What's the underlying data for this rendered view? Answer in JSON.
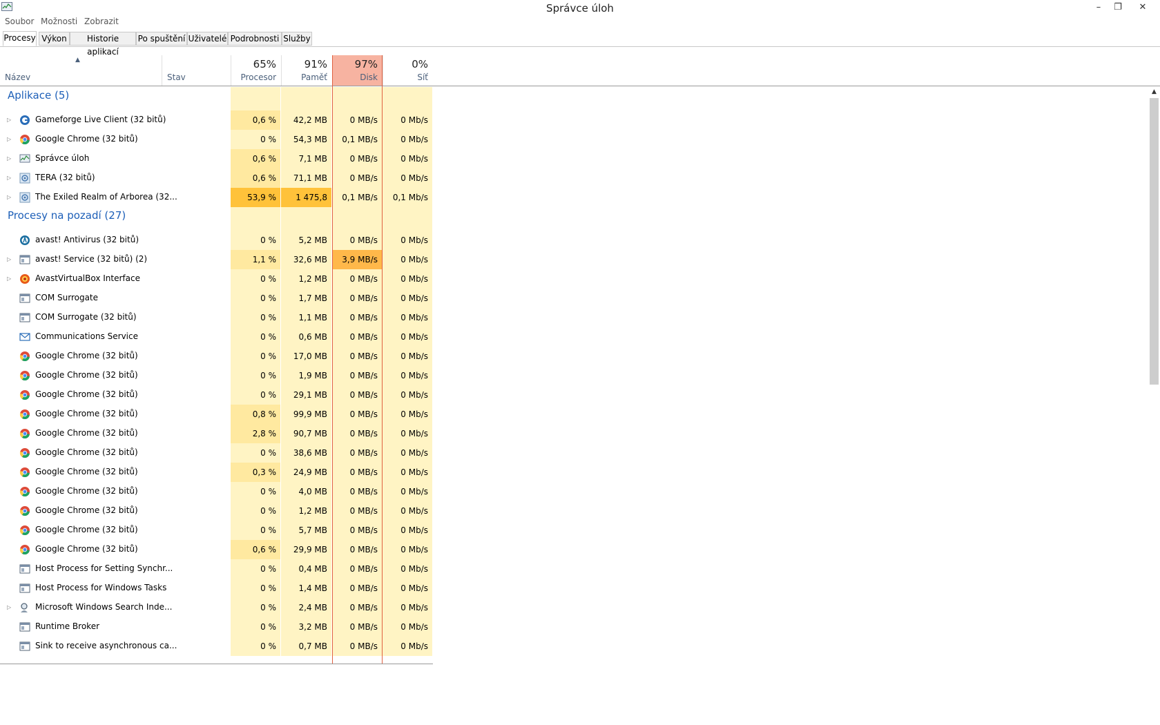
{
  "window": {
    "title": "Správce úloh",
    "minimize": "–",
    "maximize": "❐",
    "close": "✕"
  },
  "menu": [
    "Soubor",
    "Možnosti",
    "Zobrazit"
  ],
  "tabs": [
    "Procesy",
    "Výkon",
    "Historie aplikací",
    "Po spuštění",
    "Uživatelé",
    "Podrobnosti",
    "Služby"
  ],
  "active_tab": "Procesy",
  "columns": {
    "name": "Název",
    "status": "Stav",
    "cpu": {
      "pct": "65%",
      "label": "Procesor"
    },
    "mem": {
      "pct": "91%",
      "label": "Paměť"
    },
    "disk": {
      "pct": "97%",
      "label": "Disk"
    },
    "net": {
      "pct": "0%",
      "label": "Síť"
    }
  },
  "colors": {
    "accent": "#1d5fb8",
    "light_yellow": "#fff4c4",
    "medium_yellow": "#ffe9a0",
    "strong_orange": "#ffc23a",
    "disk_header": "#f7b3a1",
    "disk_highlight": "#ffb84a"
  },
  "groups": [
    {
      "title": "Aplikace (5)",
      "rows": [
        {
          "icon": "gameforge-icon",
          "name": "Gameforge Live Client (32 bitů)",
          "expand": true,
          "cpu": "0,6 %",
          "mem": "42,2 MB",
          "disk": "0 MB/s",
          "net": "0 Mb/s",
          "cpu_heat": 1,
          "mem_heat": 0,
          "disk_heat": 0
        },
        {
          "icon": "chrome-icon",
          "name": "Google Chrome (32 bitů)",
          "expand": true,
          "cpu": "0 %",
          "mem": "54,3 MB",
          "disk": "0,1 MB/s",
          "net": "0 Mb/s",
          "cpu_heat": 0,
          "mem_heat": 0,
          "disk_heat": 0
        },
        {
          "icon": "taskmanager-icon",
          "name": "Správce úloh",
          "expand": true,
          "cpu": "0,6 %",
          "mem": "7,1 MB",
          "disk": "0 MB/s",
          "net": "0 Mb/s",
          "cpu_heat": 1,
          "mem_heat": 0,
          "disk_heat": 0
        },
        {
          "icon": "tera-icon",
          "name": "TERA (32 bitů)",
          "expand": true,
          "cpu": "0,6 %",
          "mem": "71,1 MB",
          "disk": "0 MB/s",
          "net": "0 Mb/s",
          "cpu_heat": 1,
          "mem_heat": 0,
          "disk_heat": 0
        },
        {
          "icon": "tera-icon",
          "name": "The Exiled Realm of Arborea (32...",
          "expand": true,
          "cpu": "53,9 %",
          "mem": "1 475,8 MB",
          "disk": "0,1 MB/s",
          "net": "0,1 Mb/s",
          "cpu_heat": 3,
          "mem_heat": 3,
          "disk_heat": 0
        }
      ]
    },
    {
      "title": "Procesy na pozadí (27)",
      "rows": [
        {
          "icon": "avast-icon",
          "name": "avast! Antivirus (32 bitů)",
          "expand": false,
          "cpu": "0 %",
          "mem": "5,2 MB",
          "disk": "0 MB/s",
          "net": "0 Mb/s",
          "cpu_heat": 0,
          "mem_heat": 0,
          "disk_heat": 0
        },
        {
          "icon": "service-icon",
          "name": "avast! Service (32 bitů) (2)",
          "expand": true,
          "cpu": "1,1 %",
          "mem": "32,6 MB",
          "disk": "3,9 MB/s",
          "net": "0 Mb/s",
          "cpu_heat": 1,
          "mem_heat": 0,
          "disk_heat": 3
        },
        {
          "icon": "avastvb-icon",
          "name": "AvastVirtualBox Interface",
          "expand": true,
          "cpu": "0 %",
          "mem": "1,2 MB",
          "disk": "0 MB/s",
          "net": "0 Mb/s",
          "cpu_heat": 0,
          "mem_heat": 0,
          "disk_heat": 0
        },
        {
          "icon": "service-icon",
          "name": "COM Surrogate",
          "expand": false,
          "cpu": "0 %",
          "mem": "1,7 MB",
          "disk": "0 MB/s",
          "net": "0 Mb/s",
          "cpu_heat": 0,
          "mem_heat": 0,
          "disk_heat": 0
        },
        {
          "icon": "service-icon",
          "name": "COM Surrogate (32 bitů)",
          "expand": false,
          "cpu": "0 %",
          "mem": "1,1 MB",
          "disk": "0 MB/s",
          "net": "0 Mb/s",
          "cpu_heat": 0,
          "mem_heat": 0,
          "disk_heat": 0
        },
        {
          "icon": "mail-icon",
          "name": "Communications Service",
          "expand": false,
          "cpu": "0 %",
          "mem": "0,6 MB",
          "disk": "0 MB/s",
          "net": "0 Mb/s",
          "cpu_heat": 0,
          "mem_heat": 0,
          "disk_heat": 0
        },
        {
          "icon": "chrome-icon",
          "name": "Google Chrome (32 bitů)",
          "expand": false,
          "cpu": "0 %",
          "mem": "17,0 MB",
          "disk": "0 MB/s",
          "net": "0 Mb/s",
          "cpu_heat": 0,
          "mem_heat": 0,
          "disk_heat": 0
        },
        {
          "icon": "chrome-icon",
          "name": "Google Chrome (32 bitů)",
          "expand": false,
          "cpu": "0 %",
          "mem": "1,9 MB",
          "disk": "0 MB/s",
          "net": "0 Mb/s",
          "cpu_heat": 0,
          "mem_heat": 0,
          "disk_heat": 0
        },
        {
          "icon": "chrome-icon",
          "name": "Google Chrome (32 bitů)",
          "expand": false,
          "cpu": "0 %",
          "mem": "29,1 MB",
          "disk": "0 MB/s",
          "net": "0 Mb/s",
          "cpu_heat": 0,
          "mem_heat": 0,
          "disk_heat": 0
        },
        {
          "icon": "chrome-icon",
          "name": "Google Chrome (32 bitů)",
          "expand": false,
          "cpu": "0,8 %",
          "mem": "99,9 MB",
          "disk": "0 MB/s",
          "net": "0 Mb/s",
          "cpu_heat": 1,
          "mem_heat": 0,
          "disk_heat": 0
        },
        {
          "icon": "chrome-icon",
          "name": "Google Chrome (32 bitů)",
          "expand": false,
          "cpu": "2,8 %",
          "mem": "90,7 MB",
          "disk": "0 MB/s",
          "net": "0 Mb/s",
          "cpu_heat": 1,
          "mem_heat": 0,
          "disk_heat": 0
        },
        {
          "icon": "chrome-icon",
          "name": "Google Chrome (32 bitů)",
          "expand": false,
          "cpu": "0 %",
          "mem": "38,6 MB",
          "disk": "0 MB/s",
          "net": "0 Mb/s",
          "cpu_heat": 0,
          "mem_heat": 0,
          "disk_heat": 0
        },
        {
          "icon": "chrome-icon",
          "name": "Google Chrome (32 bitů)",
          "expand": false,
          "cpu": "0,3 %",
          "mem": "24,9 MB",
          "disk": "0 MB/s",
          "net": "0 Mb/s",
          "cpu_heat": 1,
          "mem_heat": 0,
          "disk_heat": 0
        },
        {
          "icon": "chrome-icon",
          "name": "Google Chrome (32 bitů)",
          "expand": false,
          "cpu": "0 %",
          "mem": "4,0 MB",
          "disk": "0 MB/s",
          "net": "0 Mb/s",
          "cpu_heat": 0,
          "mem_heat": 0,
          "disk_heat": 0
        },
        {
          "icon": "chrome-icon",
          "name": "Google Chrome (32 bitů)",
          "expand": false,
          "cpu": "0 %",
          "mem": "1,2 MB",
          "disk": "0 MB/s",
          "net": "0 Mb/s",
          "cpu_heat": 0,
          "mem_heat": 0,
          "disk_heat": 0
        },
        {
          "icon": "chrome-icon",
          "name": "Google Chrome (32 bitů)",
          "expand": false,
          "cpu": "0 %",
          "mem": "5,7 MB",
          "disk": "0 MB/s",
          "net": "0 Mb/s",
          "cpu_heat": 0,
          "mem_heat": 0,
          "disk_heat": 0
        },
        {
          "icon": "chrome-icon",
          "name": "Google Chrome (32 bitů)",
          "expand": false,
          "cpu": "0,6 %",
          "mem": "29,9 MB",
          "disk": "0 MB/s",
          "net": "0 Mb/s",
          "cpu_heat": 1,
          "mem_heat": 0,
          "disk_heat": 0
        },
        {
          "icon": "service-icon",
          "name": "Host Process for Setting Synchr...",
          "expand": false,
          "cpu": "0 %",
          "mem": "0,4 MB",
          "disk": "0 MB/s",
          "net": "0 Mb/s",
          "cpu_heat": 0,
          "mem_heat": 0,
          "disk_heat": 0
        },
        {
          "icon": "service-icon",
          "name": "Host Process for Windows Tasks",
          "expand": false,
          "cpu": "0 %",
          "mem": "1,4 MB",
          "disk": "0 MB/s",
          "net": "0 Mb/s",
          "cpu_heat": 0,
          "mem_heat": 0,
          "disk_heat": 0
        },
        {
          "icon": "search-indexer-icon",
          "name": "Microsoft Windows Search Inde...",
          "expand": true,
          "cpu": "0 %",
          "mem": "2,4 MB",
          "disk": "0 MB/s",
          "net": "0 Mb/s",
          "cpu_heat": 0,
          "mem_heat": 0,
          "disk_heat": 0
        },
        {
          "icon": "service-icon",
          "name": "Runtime Broker",
          "expand": false,
          "cpu": "0 %",
          "mem": "3,2 MB",
          "disk": "0 MB/s",
          "net": "0 Mb/s",
          "cpu_heat": 0,
          "mem_heat": 0,
          "disk_heat": 0
        },
        {
          "icon": "service-icon",
          "name": "Sink to receive asynchronous ca...",
          "expand": false,
          "cpu": "0 %",
          "mem": "0,7 MB",
          "disk": "0 MB/s",
          "net": "0 Mb/s",
          "cpu_heat": 0,
          "mem_heat": 0,
          "disk_heat": 0
        }
      ]
    }
  ]
}
